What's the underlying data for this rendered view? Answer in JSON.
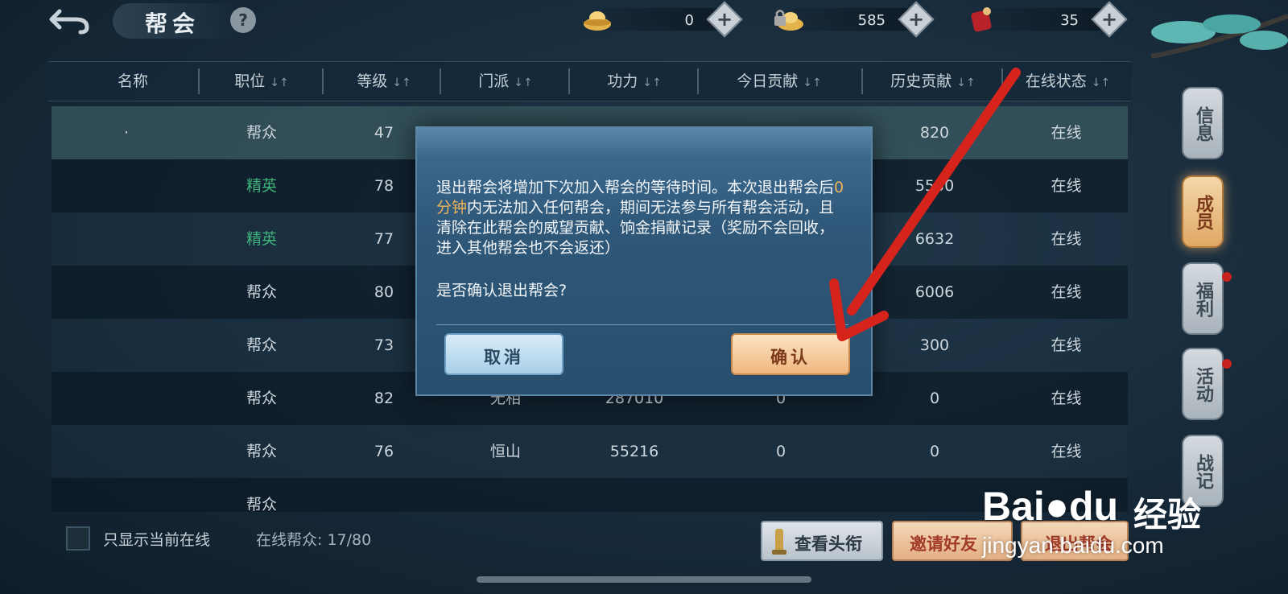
{
  "header": {
    "title": "帮会",
    "help_label": "?"
  },
  "currencies": [
    {
      "name": "silver-ingot",
      "value": "0"
    },
    {
      "name": "bound-ingot",
      "value": "585"
    },
    {
      "name": "red-pouch",
      "value": "35"
    }
  ],
  "currency_plus": "+",
  "table": {
    "columns": [
      "名称",
      "职位",
      "等级",
      "门派",
      "功力",
      "今日贡献",
      "历史贡献",
      "在线状态"
    ],
    "sort_glyph": "↓↑",
    "rows": [
      {
        "name": "·",
        "role": "帮众",
        "level": "47",
        "school": "",
        "power": "",
        "today": "",
        "history": "820",
        "status": "在线"
      },
      {
        "name": "",
        "role": "精英",
        "level": "78",
        "school": "",
        "power": "",
        "today": "",
        "history": "5530",
        "status": "在线"
      },
      {
        "name": "",
        "role": "精英",
        "level": "77",
        "school": "",
        "power": "",
        "today": "",
        "history": "6632",
        "status": "在线"
      },
      {
        "name": "",
        "role": "帮众",
        "level": "80",
        "school": "",
        "power": "",
        "today": "",
        "history": "6006",
        "status": "在线"
      },
      {
        "name": "",
        "role": "帮众",
        "level": "73",
        "school": "",
        "power": "",
        "today": "",
        "history": "300",
        "status": "在线"
      },
      {
        "name": "",
        "role": "帮众",
        "level": "82",
        "school": "无相",
        "power": "287010",
        "today": "0",
        "history": "0",
        "status": "在线"
      },
      {
        "name": "",
        "role": "帮众",
        "level": "76",
        "school": "恒山",
        "power": "55216",
        "today": "0",
        "history": "0",
        "status": "在线"
      },
      {
        "name": "",
        "role": "帮众",
        "level": "",
        "school": "",
        "power": "",
        "today": "",
        "history": "",
        "status": ""
      }
    ]
  },
  "footer": {
    "filter_label": "只显示当前在线",
    "online_count": "在线帮众: 17/80",
    "view_title_button": "查看头衔",
    "invite_button": "邀请好友",
    "exit_button": "退出帮会"
  },
  "side_tabs": [
    {
      "label": "信息",
      "active": false,
      "dot": false
    },
    {
      "label": "成员",
      "active": true,
      "dot": false
    },
    {
      "label": "福利",
      "active": false,
      "dot": true
    },
    {
      "label": "活动",
      "active": false,
      "dot": true
    },
    {
      "label": "战记",
      "active": false,
      "dot": false
    }
  ],
  "dialog": {
    "msg_part1": "退出帮会将增加下次加入帮会的等待时间。本次退出帮会后",
    "msg_highlight": "0分钟",
    "msg_part2": "内无法加入任何帮会，期间无法参与所有帮会活动，且清除在此帮会的威望贡献、饷金捐献记录（奖励不会回收，进入其他帮会也不会返还）",
    "confirm_question": "是否确认退出帮会?",
    "cancel_label": "取消",
    "confirm_label": "确认"
  },
  "watermark": {
    "brand": "Bai",
    "brand_tail": "du",
    "brand_cn": "经验",
    "url": "jingyan.baidu.com"
  },
  "colors": {
    "elite_role": "#3fb37a",
    "highlight": "#f0b35a",
    "annotation_arrow": "#d6231c"
  }
}
